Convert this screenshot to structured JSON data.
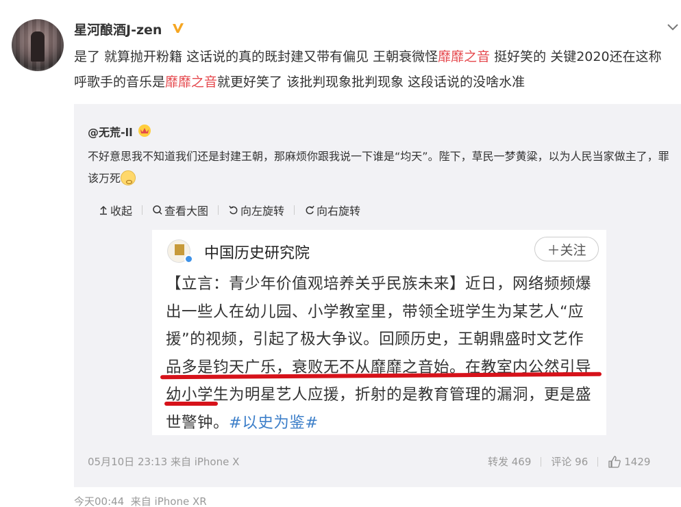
{
  "post": {
    "username": "星河酿酒J-zen",
    "text_parts": [
      "是了 就算抛开粉籍 这话说的真的既封建又带有偏见 王朝衰微怪",
      "靡靡之音",
      " 挺好笑的 关键2020还在这称呼歌手的音乐是",
      "靡靡之音",
      "就更好笑了 该批判现象批判现象 这段话说的没啥水准"
    ],
    "footer_time": "今天00:44",
    "footer_source": "来自 iPhone XR"
  },
  "quote": {
    "username": "@无荒-ll",
    "text": "不好意思我不知道我们还是封建王朝，那麻烦你跟我说一下谁是“均天”。陛下，草民一梦黄粱，以为人民当家做主了，罪该万死",
    "toolbar": {
      "collapse": "收起",
      "view_large": "查看大图",
      "rotate_left": "向左旋转",
      "rotate_right": "向右旋转"
    },
    "embed": {
      "account": "中国历史研究院",
      "follow": "＋关注",
      "body": "【立言：青少年价值观培养关乎民族未来】近日，网络频频爆出一些人在幼儿园、小学教室里，带领全班学生为某艺人“应援”的视频，引起了极大争议。回顾历史，王朝鼎盛时文艺作品多是钧天广乐，衰败无不从靡靡之音始。在教室内公然引导幼小学生为明星艺人应援，折射的是教育管理的漏洞，更是盛世警钟。",
      "tag": "#以史为鉴#"
    },
    "time": "05月10日 23:13 来自 iPhone X",
    "repost": "转发 469",
    "comment": "评论 96",
    "likes": "1429"
  },
  "colors": {
    "highlight": "#e5484d",
    "quote_bg": "#f2f2f5",
    "underline": "#d6121a",
    "tag": "#3d7fc9"
  }
}
